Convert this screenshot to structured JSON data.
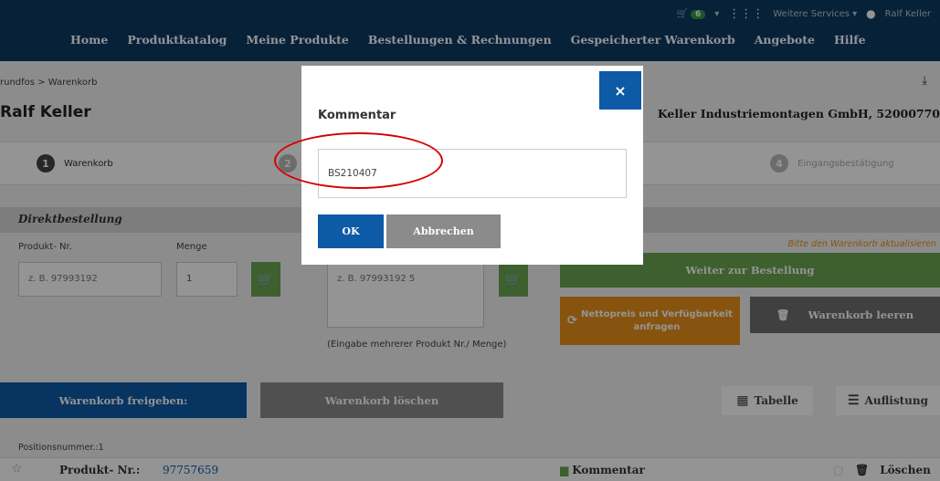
{
  "nav": {
    "cart_count": "6",
    "services": "Weitere Services",
    "user": "Ralf Keller",
    "links": [
      "Home",
      "Produktkatalog",
      "Meine Produkte",
      "Bestellungen & Rechnungen",
      "Gespeicherter Warenkorb",
      "Angebote",
      "Hilfe"
    ]
  },
  "page": {
    "breadcrumb": "rundfos > Warenkorb",
    "user_name": "Ralf Keller",
    "company": "Keller Industriemontagen GmbH, 52000770",
    "steps": [
      {
        "num": "1",
        "label": "Warenkorb"
      },
      {
        "num": "2",
        "label": ""
      },
      {
        "num": "4",
        "label": "Eingangsbestätigung"
      }
    ],
    "direktbestellung": "Direktbestellung",
    "produkt_nr_label": "Produkt- Nr.",
    "menge_label": "Menge",
    "produkt_nr_placeholder": "z. B. 97993192",
    "menge_value": "1",
    "multi_placeholder": "z. B. 97993192 5",
    "multi_hint": "(Eingabe mehrerer Produkt Nr./ Menge)",
    "update_hint": "Bitte den Warenkorb aktualisieren",
    "weiter": "Weiter zur Bestellung",
    "netto": "Nettopreis und Verfügbarkeit anfragen",
    "leeren": "Warenkorb leeren",
    "freigeben": "Warenkorb freigeben:",
    "loeschen": "Warenkorb löschen",
    "view_tabelle": "Tabelle",
    "view_auflistung": "Auflistung",
    "positionsnummer": "Positionsnummer.:1",
    "row": {
      "produkt_nr_label": "Produkt- Nr.:",
      "produkt_nr_value": "97757659",
      "kommentar": "Kommentar",
      "loeschen": "Löschen"
    }
  },
  "modal": {
    "title": "Kommentar",
    "input_value": "BS210407",
    "ok": "OK",
    "cancel": "Abbrechen",
    "close": "×"
  }
}
